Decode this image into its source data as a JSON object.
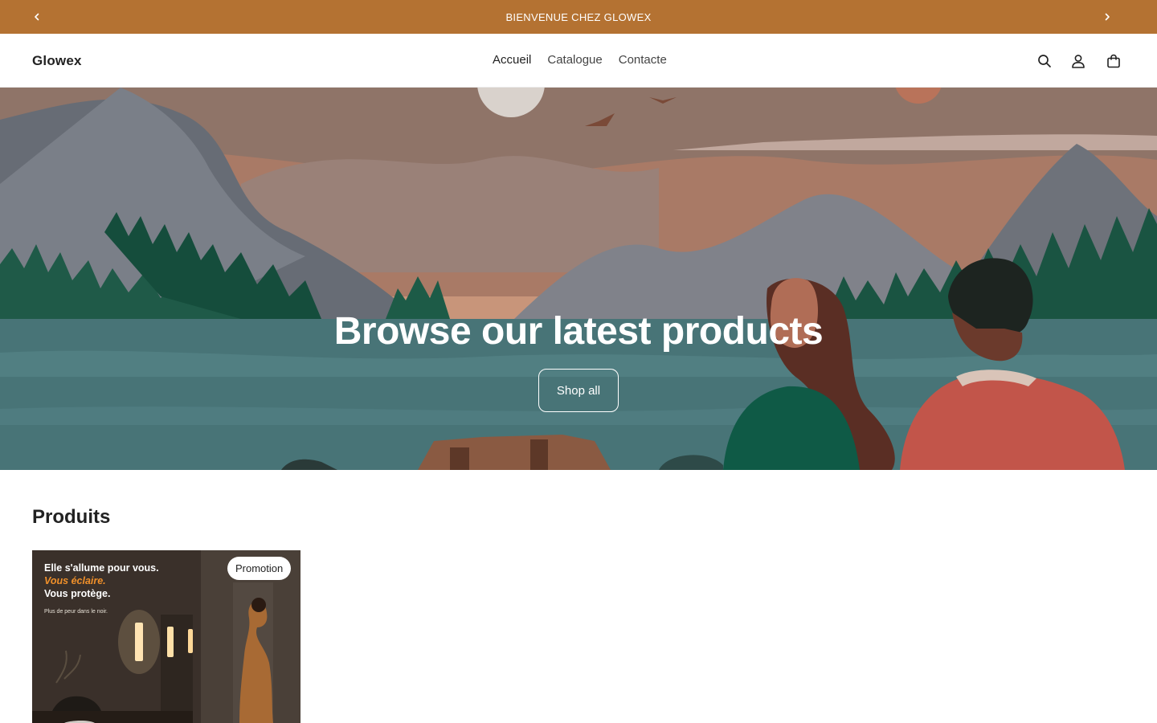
{
  "announcement": {
    "text": "BIENVENUE CHEZ GLOWEX"
  },
  "header": {
    "logo": "Glowex",
    "nav": [
      {
        "label": "Accueil",
        "active": true
      },
      {
        "label": "Catalogue"
      },
      {
        "label": "Contacte"
      }
    ],
    "icons": [
      "search-icon",
      "account-icon",
      "cart-icon"
    ]
  },
  "hero": {
    "title": "Browse our latest products",
    "button_label": "Shop all"
  },
  "products": {
    "title": "Produits",
    "items": [
      {
        "badge": "Promotion",
        "image_text": {
          "line1": "Elle s'allume pour vous.",
          "line2": "Vous éclaire.",
          "line3": "Vous protège.",
          "small": "Plus de peur dans le noir."
        }
      }
    ]
  },
  "colors": {
    "announcement_bg": "#b47232",
    "accent_orange": "#f0902a"
  }
}
